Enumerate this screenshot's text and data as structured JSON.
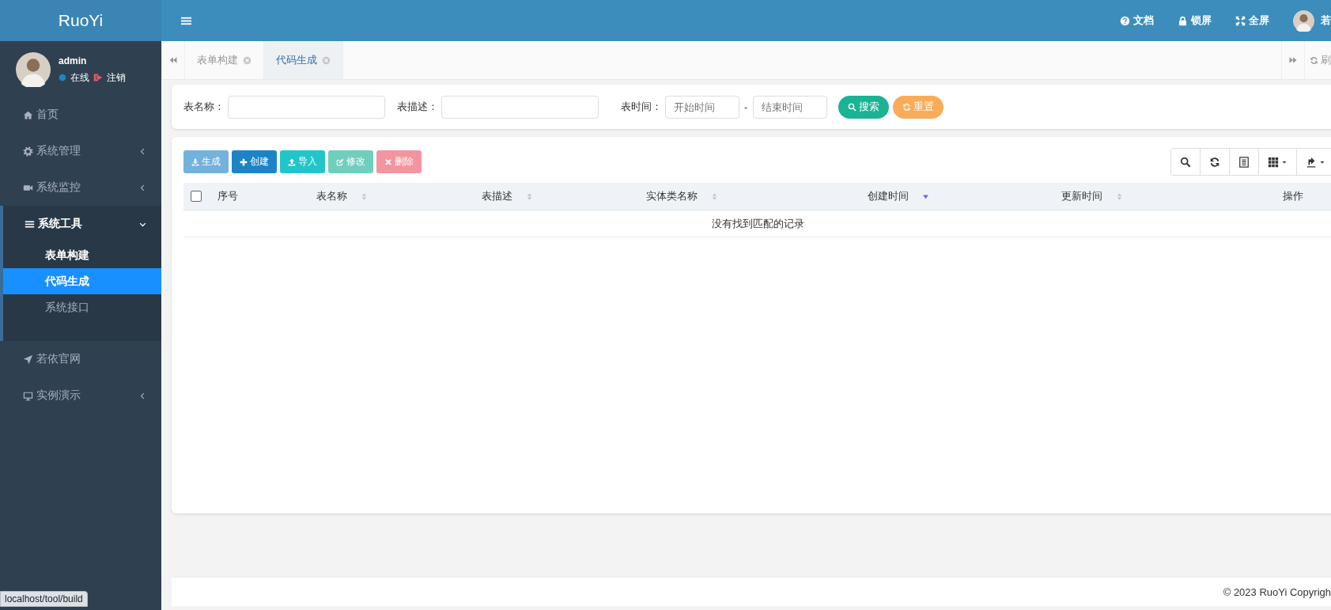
{
  "sidebar": {
    "logo": "RuoYi",
    "user": {
      "name": "admin",
      "status": "在线",
      "logout": "注销"
    },
    "menu": [
      {
        "label": "首页",
        "kind": "link"
      },
      {
        "label": "系统管理",
        "kind": "group",
        "expanded": false
      },
      {
        "label": "系统监控",
        "kind": "group",
        "expanded": false
      },
      {
        "label": "系统工具",
        "kind": "group",
        "expanded": true,
        "children": [
          {
            "label": "表单构建",
            "selected": false,
            "hovered": true
          },
          {
            "label": "代码生成",
            "selected": true,
            "hovered": false
          },
          {
            "label": "系统接口",
            "selected": false,
            "hovered": false
          }
        ]
      },
      {
        "label": "若依官网",
        "kind": "link"
      },
      {
        "label": "实例演示",
        "kind": "group",
        "expanded": false
      }
    ]
  },
  "header": {
    "actions": [
      {
        "label": "文档"
      },
      {
        "label": "锁屏"
      },
      {
        "label": "全屏"
      }
    ],
    "user_name": "若"
  },
  "tabs": [
    {
      "label": "表单构建",
      "selected": false
    },
    {
      "label": "代码生成",
      "selected": true
    }
  ],
  "refresh_tab": "刷",
  "search_form": {
    "fields": [
      {
        "kind": "text",
        "label": "表名称："
      },
      {
        "kind": "text",
        "label": "表描述："
      },
      {
        "kind": "daterange",
        "label": "表时间：",
        "start_placeholder": "开始时间",
        "separator": "-",
        "end_placeholder": "结束时间"
      }
    ],
    "buttons": [
      {
        "label": "搜索",
        "kind": "search"
      },
      {
        "label": "重置",
        "kind": "reset"
      }
    ]
  },
  "toolbar": {
    "buttons": [
      {
        "label": "生成",
        "kind": "generate",
        "disabled": true
      },
      {
        "label": "创建",
        "kind": "create",
        "disabled": false
      },
      {
        "label": "导入",
        "kind": "import",
        "disabled": false
      },
      {
        "label": "修改",
        "kind": "edit",
        "disabled": true
      },
      {
        "label": "删除",
        "kind": "delete",
        "disabled": true
      }
    ],
    "tools": [
      {
        "kind": "search"
      },
      {
        "kind": "refresh"
      },
      {
        "kind": "columns"
      },
      {
        "kind": "grid"
      },
      {
        "kind": "export"
      }
    ]
  },
  "table": {
    "select_all": {
      "checked": false
    },
    "columns": [
      {
        "label": "序号",
        "sortable": false,
        "sorted_descending": false
      },
      {
        "label": "表名称",
        "sortable": true,
        "sorted_descending": false
      },
      {
        "label": "表描述",
        "sortable": true,
        "sorted_descending": false
      },
      {
        "label": "实体类名称",
        "sortable": true,
        "sorted_descending": false
      },
      {
        "label": "创建时间",
        "sortable": true,
        "sorted_descending": true
      },
      {
        "label": "更新时间",
        "sortable": true,
        "sorted_descending": false
      },
      {
        "label": "操作",
        "sortable": false,
        "sorted_descending": false
      }
    ],
    "empty_message": "没有找到匹配的记录"
  },
  "footer": "© 2023 RuoYi Copyrigh",
  "status_url": "localhost/tool/build"
}
